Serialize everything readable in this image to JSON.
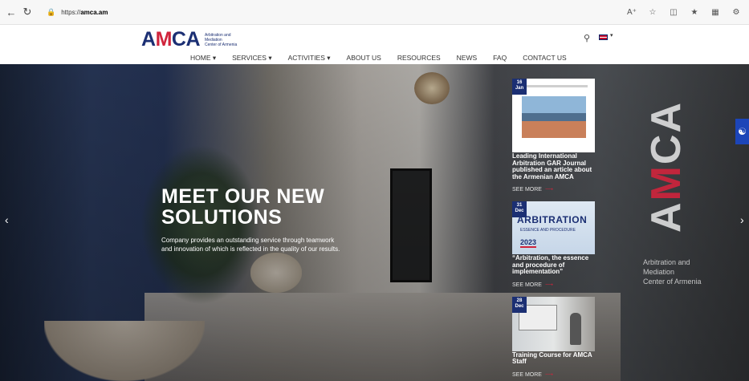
{
  "browser": {
    "url_prefix": "https://",
    "url_host": "amca.am"
  },
  "header": {
    "logo_text_a": "A",
    "logo_text_m": "M",
    "logo_text_ca": "CA",
    "logo_subtitle_1": "Arbitration and",
    "logo_subtitle_2": "Mediation",
    "logo_subtitle_3": "Center of Armenia"
  },
  "menu": [
    {
      "label": "HOME ▾"
    },
    {
      "label": "SERVICES ▾"
    },
    {
      "label": "ACTIVITIES ▾"
    },
    {
      "label": "ABOUT US"
    },
    {
      "label": "RESOURCES"
    },
    {
      "label": "NEWS"
    },
    {
      "label": "FAQ"
    },
    {
      "label": "CONTACT US"
    }
  ],
  "hero": {
    "title_line1": "MEET OUR NEW",
    "title_line2": "SOLUTIONS",
    "text": "Company provides an outstanding service through teamwork and innovation of which is reflected in the quality of our results."
  },
  "side_brand": {
    "a": "A",
    "m": "M",
    "ca": "CA",
    "caption_1": "Arbitration and",
    "caption_2": "Mediation",
    "caption_3": "Center of Armenia"
  },
  "news": [
    {
      "day": "16",
      "month": "Jan",
      "title": "Leading International Arbitration GAR Journal published an article about the Armenian AMCA",
      "see_more": "SEE MORE"
    },
    {
      "day": "31",
      "month": "Dec",
      "title": "“Arbitration, the essence and procedure of implementation”",
      "see_more": "SEE MORE",
      "thumb_big": "ARBITRATION",
      "thumb_small": "ESSENCE AND PROCEDURE",
      "thumb_year": "2023"
    },
    {
      "day": "28",
      "month": "Dec",
      "title": "Training Course for AMCA Staff",
      "see_more": "SEE MORE"
    }
  ],
  "colors": {
    "brand_blue": "#1b2f73",
    "brand_red": "#d0243c",
    "access_blue": "#1c45b8"
  },
  "icons": [
    "back-icon",
    "reload-icon",
    "lock-icon",
    "read-aloud-icon",
    "favorite-icon",
    "split-icon",
    "favorites-bar-icon",
    "collections-icon",
    "extensions-icon",
    "search-icon",
    "flag-icon",
    "chevron-left-icon",
    "chevron-right-icon",
    "accessibility-icon"
  ]
}
